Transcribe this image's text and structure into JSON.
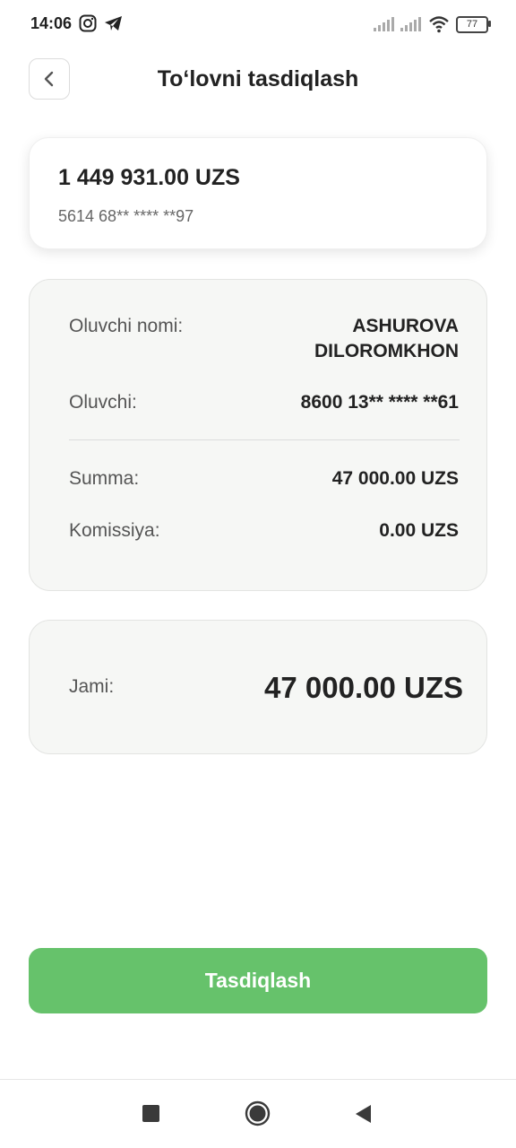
{
  "status_bar": {
    "time": "14:06",
    "battery": "77",
    "icons": [
      "instagram-icon",
      "telegram-icon",
      "signal-icon",
      "signal-icon",
      "wifi-icon",
      "battery-icon"
    ]
  },
  "header": {
    "title": "To‘lovni tasdiqlash",
    "back_icon": "chevron-left-icon"
  },
  "card": {
    "balance": "1 449 931.00 UZS",
    "number": "5614 68** **** **97"
  },
  "details": {
    "recipient_name_label": "Oluvchi nomi:",
    "recipient_name_line1": "ASHUROVA",
    "recipient_name_line2": "DILOROMKHON",
    "recipient_label": "Oluvchi:",
    "recipient_value": "8600 13** **** **61",
    "amount_label": "Summa:",
    "amount_value": "47 000.00 UZS",
    "fee_label": "Komissiya:",
    "fee_value": "0.00 UZS"
  },
  "total": {
    "label": "Jami:",
    "value": "47 000.00 UZS"
  },
  "actions": {
    "confirm_label": "Tasdiqlash"
  },
  "colors": {
    "accent": "#66c26b",
    "panel_bg": "#f6f7f5"
  }
}
